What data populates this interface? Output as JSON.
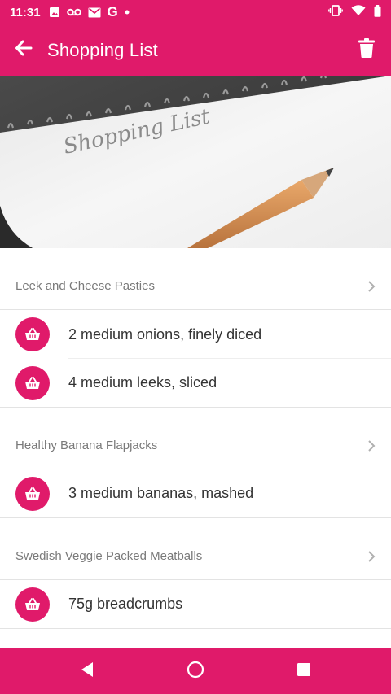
{
  "status_bar": {
    "time": "11:31",
    "notification_icons": [
      "image-icon",
      "voicemail-icon",
      "gmail-icon",
      "google-icon",
      "dot-icon"
    ],
    "system_icons": [
      "vibrate-icon",
      "wifi-icon",
      "battery-icon"
    ]
  },
  "app_bar": {
    "title": "Shopping List",
    "back_icon": "arrow-back-icon",
    "action_icon": "trash-icon"
  },
  "hero": {
    "notebook_text": "Shopping List"
  },
  "sections": [
    {
      "recipe": "Leek and Cheese Pasties",
      "items": [
        "2 medium onions, finely diced",
        "4 medium leeks, sliced"
      ]
    },
    {
      "recipe": "Healthy Banana Flapjacks",
      "items": [
        "3 medium bananas, mashed"
      ]
    },
    {
      "recipe": "Swedish Veggie Packed Meatballs",
      "items": [
        "75g breadcrumbs"
      ]
    }
  ],
  "colors": {
    "accent": "#e01a6a",
    "divider": "#e3e3e3",
    "header_text": "#7a7a7a"
  },
  "nav_bar": [
    "back-triangle-icon",
    "home-circle-icon",
    "recents-square-icon"
  ]
}
